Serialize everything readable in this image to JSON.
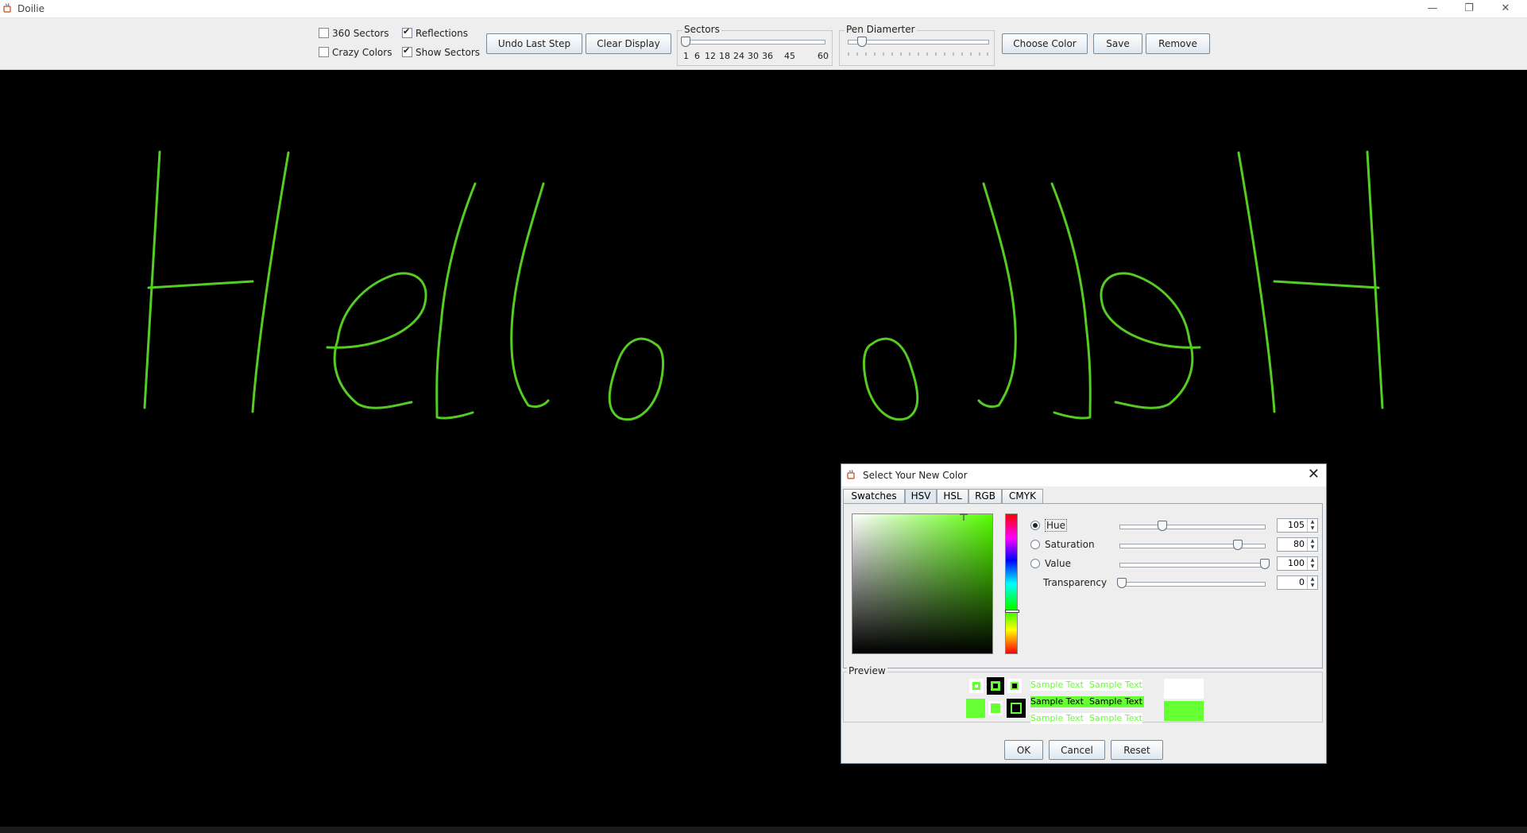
{
  "window": {
    "title": "Doilie"
  },
  "toolbar": {
    "checkboxes": [
      {
        "label": "360 Sectors",
        "checked": false
      },
      {
        "label": "Reflections",
        "checked": true
      },
      {
        "label": "Crazy Colors",
        "checked": false
      },
      {
        "label": "Show Sectors",
        "checked": true
      }
    ],
    "undo_label": "Undo Last Step",
    "clear_label": "Clear Display",
    "sectors": {
      "title": "Sectors",
      "tick_labels": [
        "1",
        "6",
        "12",
        "18",
        "24",
        "30",
        "36",
        "45",
        "60"
      ],
      "value": 1
    },
    "pen": {
      "title": "Pen Diamerter"
    },
    "choose_color_label": "Choose Color",
    "save_label": "Save",
    "remove_label": "Remove"
  },
  "drawing": {
    "stroke_color": "#55cc22",
    "background": "#000000"
  },
  "color_dialog": {
    "title": "Select Your New Color",
    "tabs": [
      "Swatches",
      "HSV",
      "HSL",
      "RGB",
      "CMYK"
    ],
    "active_tab": "HSV",
    "hue": {
      "label": "Hue",
      "value": "105"
    },
    "saturation": {
      "label": "Saturation",
      "value": "80"
    },
    "value": {
      "label": "Value",
      "value": "100"
    },
    "transparency": {
      "label": "Transparency",
      "value": "0"
    },
    "preview": {
      "title": "Preview",
      "sample_text": "Sample Text",
      "color": "#66ff33"
    },
    "ok_label": "OK",
    "cancel_label": "Cancel",
    "reset_label": "Reset"
  }
}
